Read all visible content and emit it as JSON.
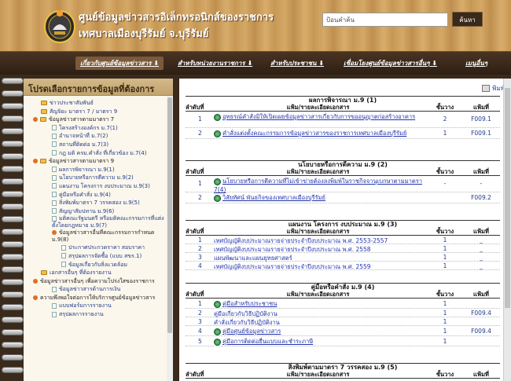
{
  "header": {
    "title_line1": "ศูนย์ข้อมูลข่าวสารอิเล็กทรอนิกส์ของราชการ",
    "title_line2": "เทศบาลเมืองบุรีรัมย์ จ.บุรีรัมย์",
    "search_placeholder": "ป้อนคำค้น",
    "search_button": "ค้นหา"
  },
  "nav": {
    "items": [
      "เกี่ยวกับศูนย์ข้อมูลข่าวสาร ⬇",
      "สำหรับหน่วยงานราชการ ⬇",
      "สำหรับประชาชน ⬇",
      "เชื่อมโยงศูนย์ข้อมูลข่าวสารอื่นๆ ⬇",
      "เมนูอื่นๆ"
    ]
  },
  "sidebar": {
    "title": "โปรดเลือกรายการข้อมูลที่ต้องการ",
    "items": [
      "ข่าวประชาสัมพันธ์",
      "สัญจิยะ มาตรา 7 / มาตรา 9",
      "ข้อมูลข่าวสารตามมาตรา 7",
      "โครงสร้างองค์กร ม.7(1)",
      "อำนาจหน้าที่ ม.7(2)",
      "สถานที่ติดต่อ ม.7(3)",
      "กฎ มติ ครม.คำสั่ง ที่เกี่ยวข้อง ม.7(4)",
      "ข้อมูลข่าวสารตามมาตรา 9",
      "ผลการพิจารณา ม.9(1)",
      "นโยบายหรือการตีความ ม.9(2)",
      "แผนงาน โครงการ งบประมาณ ม.9(3)",
      "คู่มือหรือคำสั่ง ม.9(4)",
      "สิ่งพิมพ์มาตรา 7 วรรคสอง ม.9(5)",
      "สัญญาสัมปทาน ม.9(6)",
      "มติคณะรัฐมนตรี หรือมติคณะกรรมการที่แต่งตั้งโดยกฎหมาย ม.9(7)",
      "ข้อมูลข่าวสารอื่นที่คณะกรรมการกำหนด ม.9(8)",
      "ประกาศประกวดราคา สอบราคา",
      "สรุปผลการจัดซื้อ (แบบ สขร.1)",
      "ข้อมูลเกี่ยวกับสิ่งแวดล้อม",
      "เอกสารอื่นๆ ที่ต้องรายงาน",
      "ข้อมูลข่าวสารอื่นๆ เพื่อความโปร่งใสของราชการ",
      "ข้อมูลข่าวสารด้านการเงิน",
      "ความพึงพอใจต่อการให้บริการศูนย์ข้อมูลข่าวสาร",
      "แบบฟอร์มการรายงาน",
      "สรุปผลการรายงาน"
    ]
  },
  "main": {
    "print_label": "พิมพ์",
    "headers": {
      "no": "ลำดับที่",
      "desc": "แฟ้ม/รายละเอียดเอกสาร",
      "shelf": "ชั้นวาง",
      "file": "แฟ้มที่"
    },
    "sections": [
      {
        "title": "ผลการพิจารณา ม.9 (1)",
        "rows": [
          {
            "no": "1",
            "desc": "อุทธรณ์คำสั่งมิให้เปิดเผยข้อมูลข่าวสารเกี่ยวกับการขออนุญาตก่อสร้างอาคาร",
            "shelf": "2",
            "file": "F009.1"
          },
          {
            "no": "2",
            "desc": "คำสั่งแต่งตั้งคณะกรรมการข้อมูลข่าวสารของราชการเทศบาลเมืองบุรีรัมย์",
            "shelf": "1",
            "file": "F009.1"
          }
        ]
      },
      {
        "title": "นโยบายหรือการตีความ ม.9 (2)",
        "rows": [
          {
            "no": "1",
            "desc": "นโยบายหรือการตีความที่ไม่เข้าข่ายต้องลงพิมพ์ในราชกิจจานุเบกษาตามมาตรา 7(4)",
            "shelf": "-",
            "file": "-"
          },
          {
            "no": "2",
            "desc": "วิสัยทัศน์ พันธกิจของเทศบาลเมืองบุรีรัมย์",
            "shelf": "",
            "file": "F009.2"
          }
        ]
      },
      {
        "title": "แผนงาน โครงการ งบประมาณ ม.9 (3)",
        "rows": [
          {
            "no": "1",
            "desc": "เทศบัญญัติงบประมาณรายจ่ายประจำปีงบประมาณ พ.ศ. 2553-2557",
            "shelf": "1",
            "file": "_"
          },
          {
            "no": "2",
            "desc": "เทศบัญญัติงบประมาณรายจ่ายประจำปีงบประมาณ พ.ศ. 2558",
            "shelf": "1",
            "file": "_"
          },
          {
            "no": "3",
            "desc": "แผนพัฒนาและแผนยุทธศาสตร์",
            "shelf": "1",
            "file": "_"
          },
          {
            "no": "4",
            "desc": "เทศบัญญัติงบประมาณรายจ่ายประจำปีงบประมาณ พ.ศ. 2559",
            "shelf": "1",
            "file": "_"
          }
        ]
      },
      {
        "title": "คู่มือหรือคำสั่ง ม.9 (4)",
        "rows": [
          {
            "no": "1",
            "desc": "คู่มือสำหรับประชาชน",
            "shelf": "1",
            "file": ""
          },
          {
            "no": "2",
            "desc": "คู่มือเกี่ยวกับวิธีปฏิบัติงาน",
            "shelf": "1",
            "file": "F009.4"
          },
          {
            "no": "3",
            "desc": "คำสั่งเกี่ยวกับวิธีปฏิบัติงาน",
            "shelf": "1",
            "file": ""
          },
          {
            "no": "4",
            "desc": "คู่มือศูนย์ข้อมูลข่าวสาร",
            "shelf": "1",
            "file": "F009.4"
          },
          {
            "no": "5",
            "desc": "คู่มือการติดต่อยื่นแบบและชำระภาษี",
            "shelf": "1",
            "file": ""
          }
        ]
      },
      {
        "title": "สิ่งพิมพ์ตามมาตรา 7 วรรคสอง ม.9 (5)",
        "rows": []
      }
    ]
  }
}
